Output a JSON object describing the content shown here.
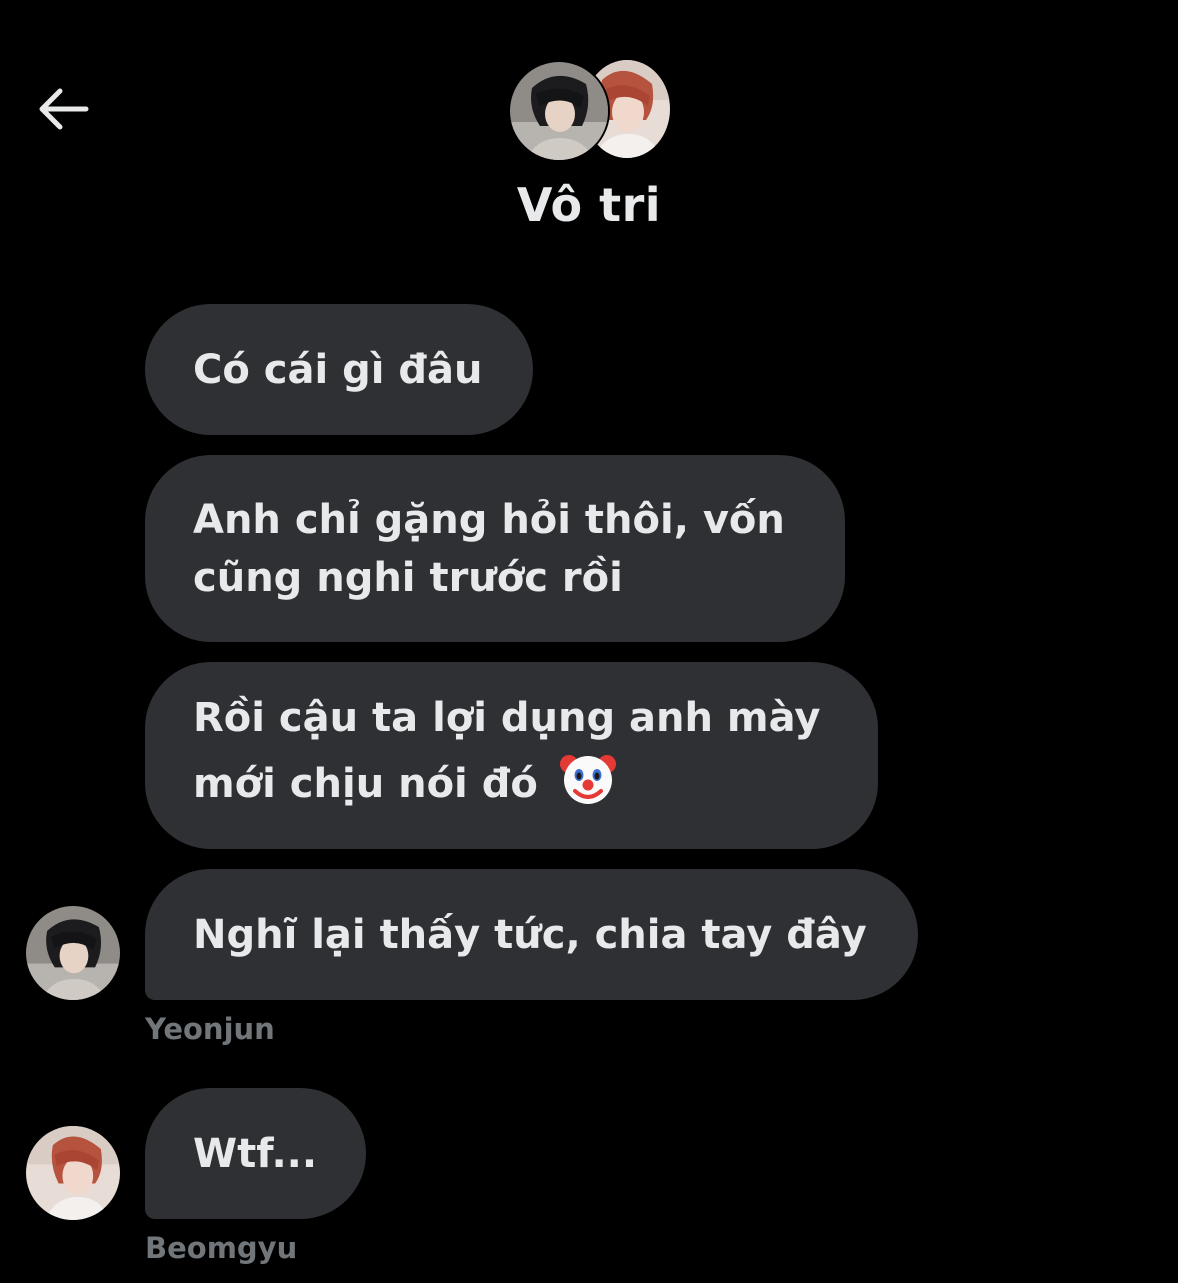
{
  "header": {
    "back_icon": "arrow-left-icon",
    "title": "Vô tri"
  },
  "messages": [
    {
      "text": "Có cái gì đâu"
    },
    {
      "text_lines": [
        "Anh chỉ gặng hỏi thôi, vốn",
        "cũng nghi trước rồi"
      ]
    },
    {
      "text_lines": [
        "Rồi cậu ta lợi dụng anh mày",
        "mới chịu nói đó"
      ],
      "emoji": "clown-face-icon"
    },
    {
      "text": "Nghĩ lại thấy tức, chia tay đây",
      "sender": "Yeonjun"
    },
    {
      "text": "Wtf...",
      "sender": "Beomgyu"
    }
  ],
  "colors": {
    "background": "#000000",
    "bubble": "#2f3034",
    "text": "#e7e9ea",
    "secondary_text": "#71767b"
  }
}
